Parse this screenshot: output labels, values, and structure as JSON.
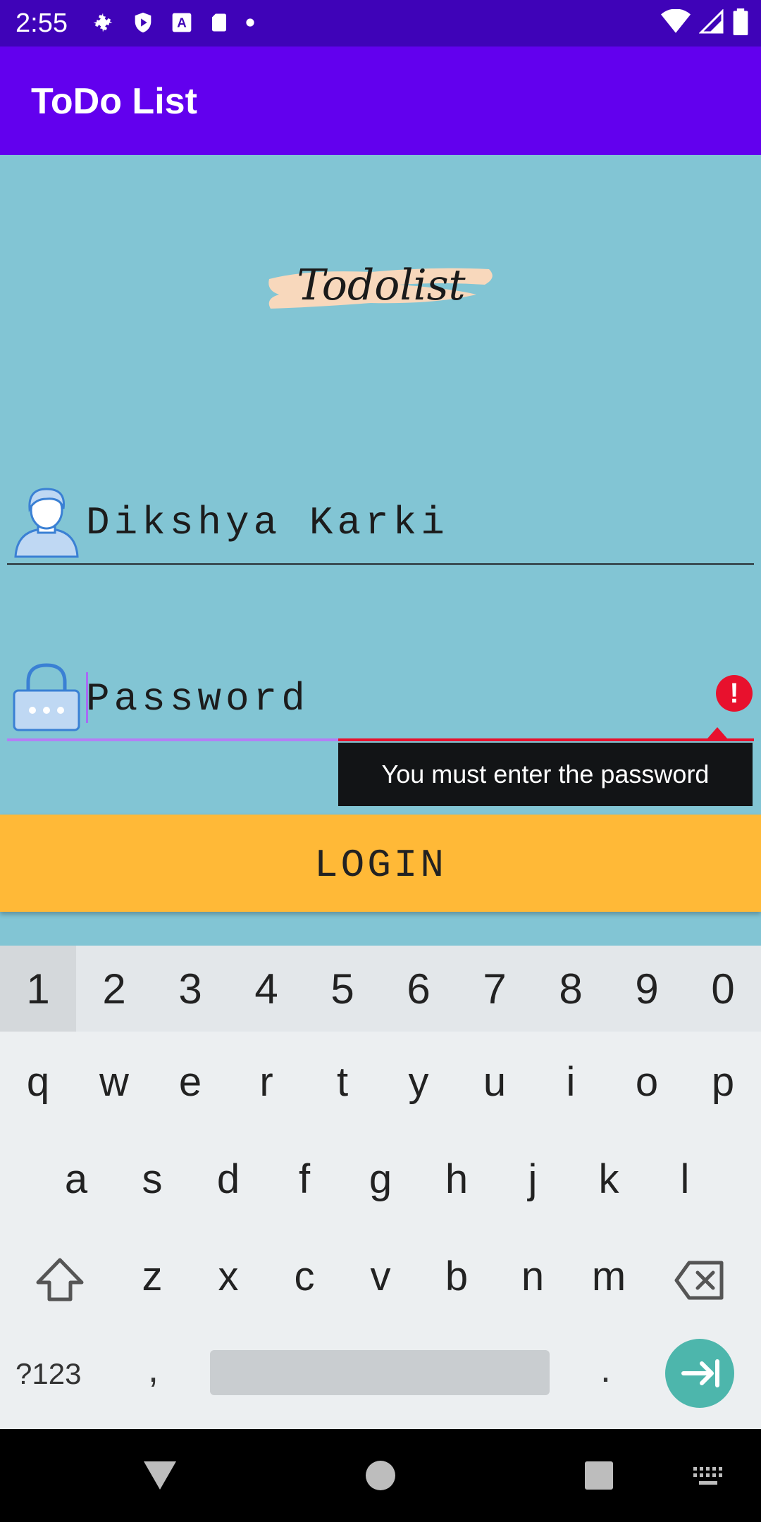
{
  "status_bar": {
    "time": "2:55"
  },
  "app_bar": {
    "title": "ToDo List"
  },
  "logo": {
    "text": "Todolist"
  },
  "username_field": {
    "value": "Dikshya Karki"
  },
  "password_field": {
    "placeholder": "Password",
    "error": "You must enter the password"
  },
  "login_button": {
    "label": "LOGIN"
  },
  "keyboard": {
    "numbers": [
      "1",
      "2",
      "3",
      "4",
      "5",
      "6",
      "7",
      "8",
      "9",
      "0"
    ],
    "row1": [
      "q",
      "w",
      "e",
      "r",
      "t",
      "y",
      "u",
      "i",
      "o",
      "p"
    ],
    "row2": [
      "a",
      "s",
      "d",
      "f",
      "g",
      "h",
      "j",
      "k",
      "l"
    ],
    "row3": [
      "z",
      "x",
      "c",
      "v",
      "b",
      "n",
      "m"
    ],
    "symbols_key": "?123",
    "comma_key": ",",
    "period_key": "."
  },
  "colors": {
    "status_bar": "#3F03B8",
    "app_bar": "#6200EE",
    "background": "#82C5D4",
    "button": "#FFB937",
    "error": "#E8112D",
    "enter": "#4DB6AC"
  }
}
